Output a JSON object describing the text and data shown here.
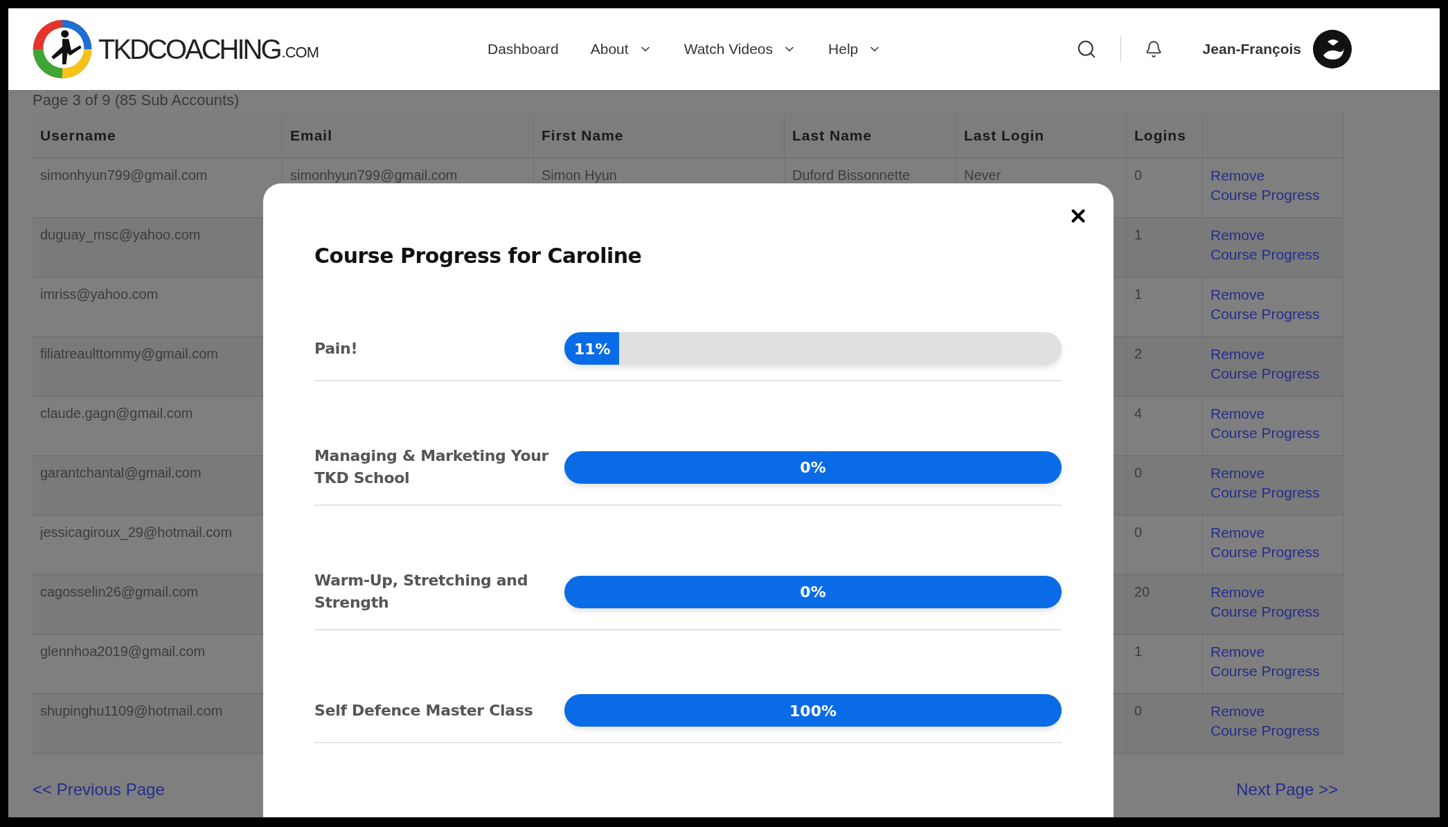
{
  "header": {
    "logo": {
      "name": "TKDCOACHING",
      "suffix": ".COM"
    },
    "nav": [
      {
        "label": "Dashboard",
        "has_menu": false
      },
      {
        "label": "About",
        "has_menu": true
      },
      {
        "label": "Watch Videos",
        "has_menu": true
      },
      {
        "label": "Help",
        "has_menu": true
      }
    ],
    "user": {
      "name": "Jean-François"
    }
  },
  "page_info": "Page 3 of 9 (85 Sub Accounts)",
  "table": {
    "columns": [
      "Username",
      "Email",
      "First Name",
      "Last Name",
      "Last Login",
      "Logins"
    ],
    "rows": [
      {
        "username": "simonhyun799@gmail.com",
        "email": "simonhyun799@gmail.com",
        "first_name": "Simon Hyun",
        "last_name": "Duford Bissonnette",
        "last_login": "Never",
        "logins": "0",
        "actions": [
          "Remove",
          "Course Progress"
        ]
      },
      {
        "username": "duguay_msc@yahoo.com",
        "logins": "1",
        "actions": [
          "Remove",
          "Course Progress"
        ]
      },
      {
        "username": "imriss@yahoo.com",
        "logins": "1",
        "actions": [
          "Remove",
          "Course Progress"
        ]
      },
      {
        "username": "filiatreaulttommy@gmail.com",
        "logins": "2",
        "actions": [
          "Remove",
          "Course Progress"
        ]
      },
      {
        "username": "claude.gagn@gmail.com",
        "logins": "4",
        "actions": [
          "Remove",
          "Course Progress"
        ]
      },
      {
        "username": "garantchantal@gmail.com",
        "logins": "0",
        "actions": [
          "Remove",
          "Course Progress"
        ]
      },
      {
        "username": "jessicagiroux_29@hotmail.com",
        "logins": "0",
        "actions": [
          "Remove",
          "Course Progress"
        ]
      },
      {
        "username": "cagosselin26@gmail.com",
        "logins": "20",
        "actions": [
          "Remove",
          "Course Progress"
        ]
      },
      {
        "username": "glennhoa2019@gmail.com",
        "logins": "1",
        "actions": [
          "Remove",
          "Course Progress"
        ]
      },
      {
        "username": "shupinghu1109@hotmail.com",
        "logins": "0",
        "actions": [
          "Remove",
          "Course Progress"
        ]
      }
    ]
  },
  "pagination": {
    "previous": "<< Previous Page",
    "next": "Next Page >>"
  },
  "modal": {
    "title": "Course Progress for Caroline",
    "courses": [
      {
        "name": "Pain!",
        "level": 0.11,
        "reading": "11%"
      },
      {
        "name": "Managing & Marketing Your TKD School",
        "level": 1,
        "reading": "0%"
      },
      {
        "name": "Warm-Up, Stretching and Strength",
        "level": 1,
        "reading": "0%"
      },
      {
        "name": "Self Defence Master Class",
        "level": 1,
        "reading": "100%"
      }
    ]
  }
}
